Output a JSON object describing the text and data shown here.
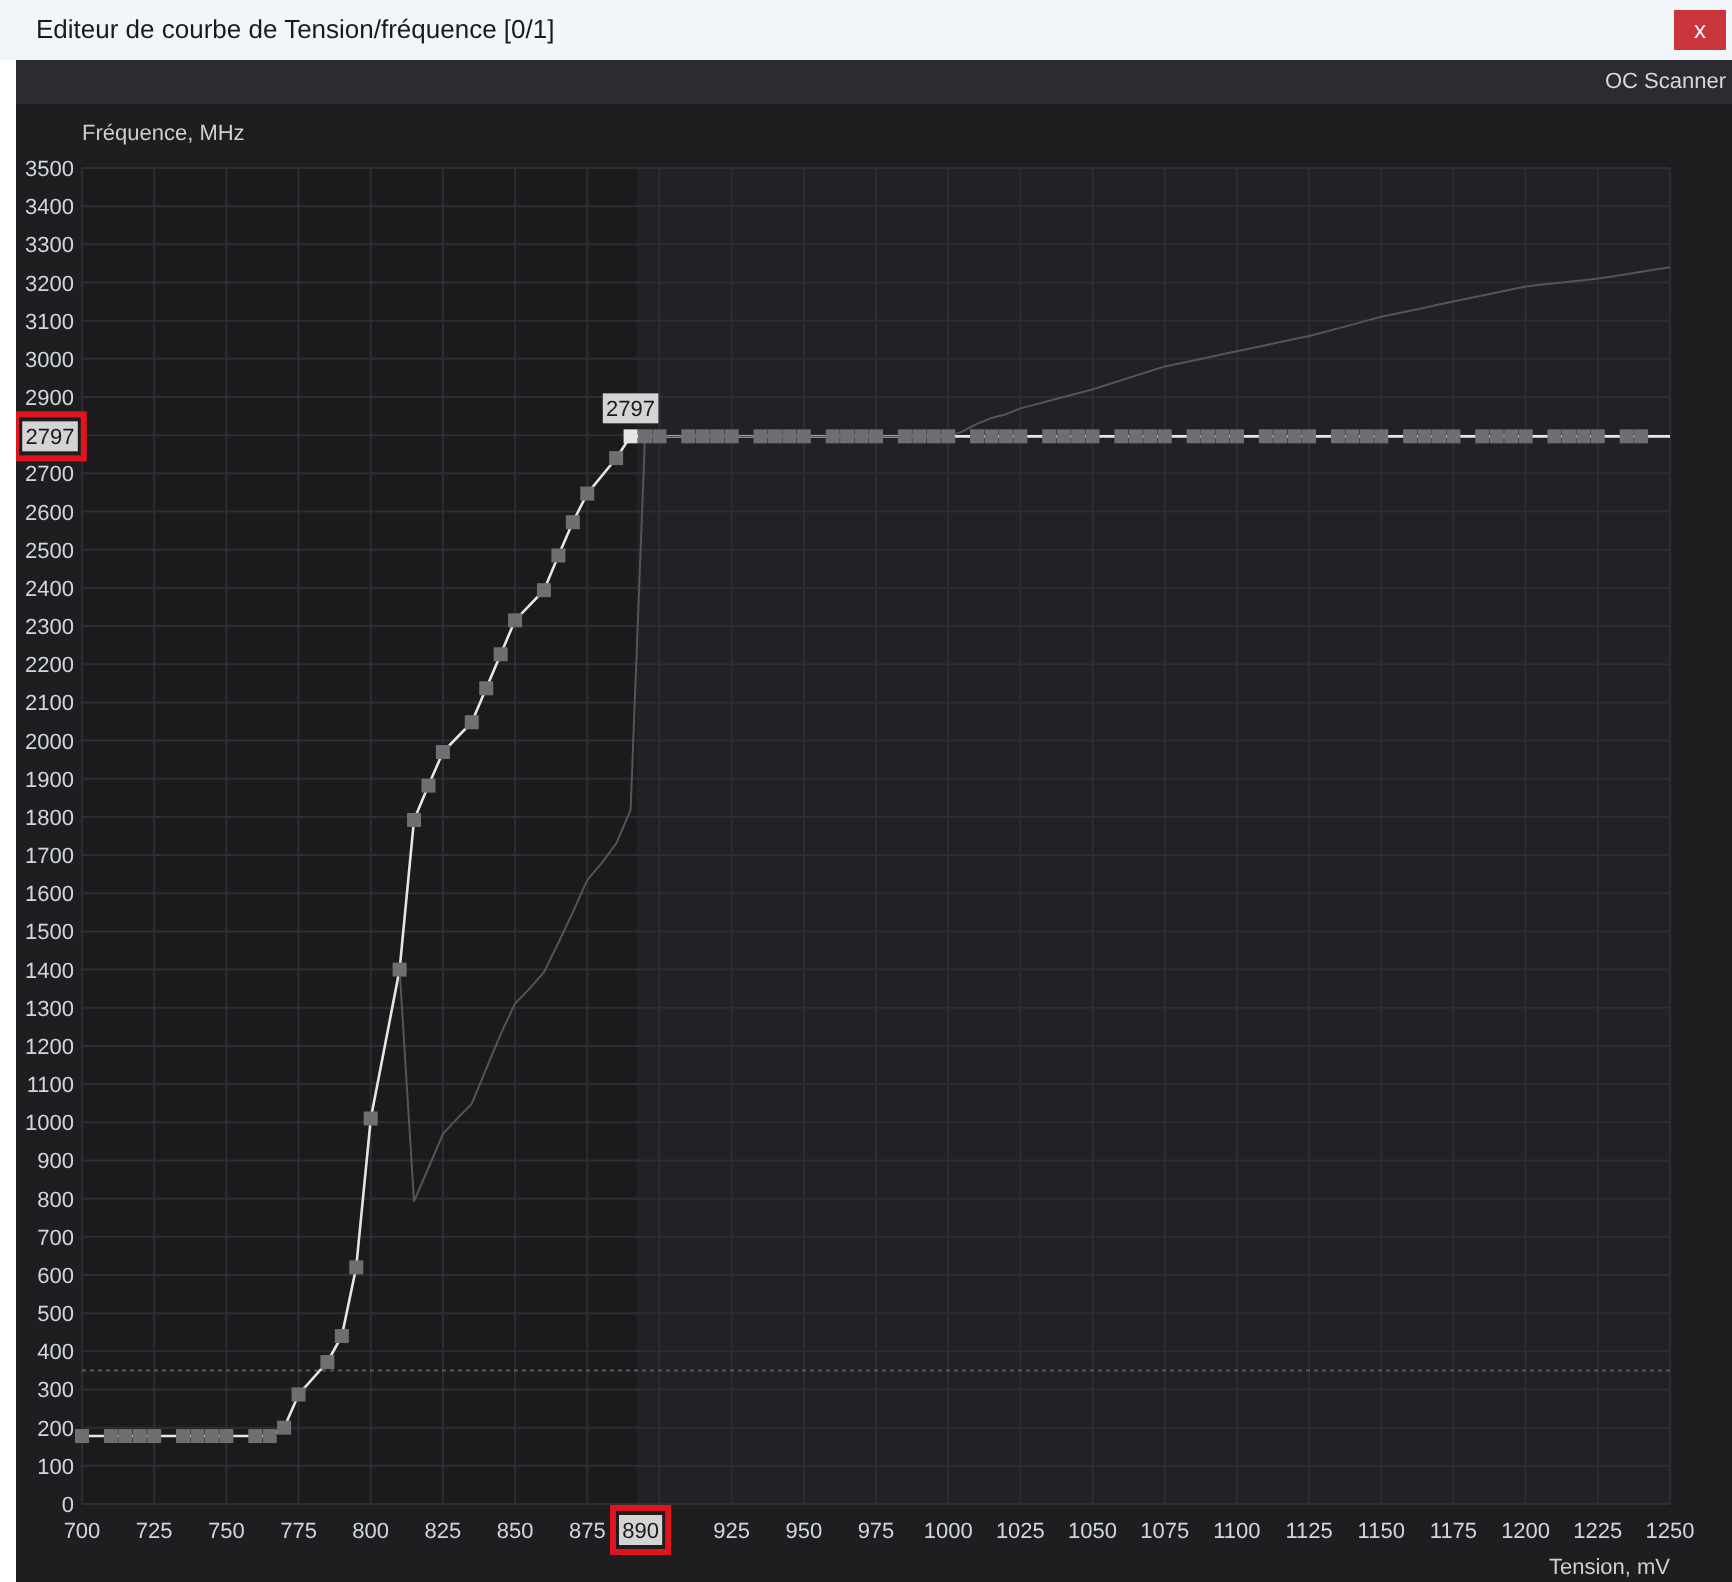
{
  "window": {
    "title": "Editeur de courbe de Tension/fréquence [0/1]",
    "close_label": "x"
  },
  "toolbar": {
    "button": "OC Scanner"
  },
  "chart": {
    "cursor": {
      "y_label": "2797",
      "x_label": "890",
      "highlighted": true
    },
    "chart_data": {
      "type": "line",
      "xlabel": "Tension, mV",
      "ylabel": "Fréquence, MHz",
      "xlim": [
        700,
        1250
      ],
      "ylim": [
        0,
        3500
      ],
      "grid": true,
      "xticks": [
        700,
        725,
        750,
        775,
        800,
        825,
        850,
        875,
        925,
        950,
        975,
        1000,
        1025,
        1050,
        1075,
        1100,
        1125,
        1150,
        1175,
        1200,
        1225,
        1250
      ],
      "yticks": [
        0,
        100,
        200,
        300,
        400,
        500,
        600,
        700,
        800,
        900,
        1000,
        1100,
        1200,
        1300,
        1400,
        1500,
        1600,
        1700,
        1800,
        1900,
        2000,
        2100,
        2200,
        2300,
        2400,
        2500,
        2600,
        2700,
        2900,
        3000,
        3100,
        3200,
        3300,
        3400,
        3500
      ],
      "x": [
        700,
        710,
        715,
        720,
        725,
        735,
        740,
        745,
        750,
        760,
        765,
        770,
        775,
        785,
        790,
        795,
        800,
        810,
        815,
        820,
        825,
        830,
        835,
        840,
        845,
        850,
        855,
        860,
        865,
        870,
        875,
        880,
        885,
        890,
        895,
        900,
        905,
        910,
        915,
        920,
        925,
        930,
        935,
        940,
        945,
        950,
        955,
        960,
        965,
        970,
        975,
        980,
        985,
        990,
        995,
        1000,
        1005,
        1010,
        1015,
        1020,
        1025,
        1030,
        1035,
        1040,
        1045,
        1050,
        1055,
        1060,
        1065,
        1070,
        1075,
        1080,
        1085,
        1090,
        1095,
        1100,
        1105,
        1110,
        1115,
        1120,
        1125,
        1130,
        1135,
        1140,
        1145,
        1150,
        1155,
        1160,
        1165,
        1170,
        1175,
        1180,
        1185,
        1190,
        1195,
        1200,
        1205,
        1210,
        1215,
        1220,
        1225,
        1230,
        1235,
        1240,
        1245,
        1250
      ],
      "series": [
        {
          "color": "#e6e6e6",
          "marker": "square",
          "values": [
            178,
            178,
            178,
            178,
            178,
            178,
            178,
            178,
            178,
            178,
            178,
            200,
            287,
            372,
            440,
            620,
            1010,
            1400,
            1792,
            1882,
            1970,
            null,
            2048,
            2137,
            2226,
            2315,
            null,
            2394,
            2485,
            2572,
            2647,
            null,
            2740,
            2797,
            2797,
            2797,
            null,
            2797,
            2797,
            2797,
            2797,
            null,
            2797,
            2797,
            2797,
            2797,
            null,
            2797,
            2797,
            2797,
            2797,
            null,
            2797,
            2797,
            2797,
            2797,
            null,
            2797,
            2797,
            2797,
            2797,
            null,
            2797,
            2797,
            2797,
            2797,
            null,
            2797,
            2797,
            2797,
            2797,
            null,
            2797,
            2797,
            2797,
            2797,
            null,
            2797,
            2797,
            2797,
            2797,
            null,
            2797,
            2797,
            2797,
            2797,
            null,
            2797,
            2797,
            2797,
            2797,
            null,
            2797,
            2797,
            2797,
            2797,
            null,
            2797,
            2797,
            2797,
            2797,
            null,
            2797,
            2797,
            null,
            2797
          ]
        },
        {
          "color": "#555558",
          "values": [
            null,
            null,
            null,
            null,
            null,
            null,
            null,
            null,
            null,
            null,
            null,
            null,
            null,
            null,
            null,
            null,
            null,
            1400,
            793,
            880,
            970,
            1010,
            1049,
            1140,
            1230,
            1311,
            1350,
            1393,
            1470,
            1550,
            1634,
            1680,
            1730,
            1818,
            2797,
            2797,
            2797,
            2797,
            2797,
            2797,
            2797,
            2797,
            2797,
            2797,
            2797,
            2797,
            2797,
            2797,
            2797,
            2797,
            2797,
            2797,
            2797,
            2797,
            2797,
            2797,
            2810,
            2830,
            2845,
            2855,
            2870,
            2880,
            2890,
            2900,
            2910,
            2920,
            2932,
            2944,
            2956,
            2968,
            2980,
            2988,
            2996,
            3004,
            3012,
            3020,
            3028,
            3036,
            3044,
            3052,
            3060,
            3070,
            3080,
            3090,
            3100,
            3110,
            3118,
            3126,
            3134,
            3142,
            3150,
            3158,
            3166,
            3174,
            3182,
            3190,
            3194,
            3198,
            3202,
            3206,
            3210,
            3216,
            3222,
            3228,
            3234,
            3240
          ]
        }
      ],
      "annotations": [
        {
          "text": "2797",
          "x": 890,
          "y": 2797
        }
      ],
      "ref_lines": [
        {
          "axis": "y",
          "value": 350
        }
      ]
    }
  }
}
